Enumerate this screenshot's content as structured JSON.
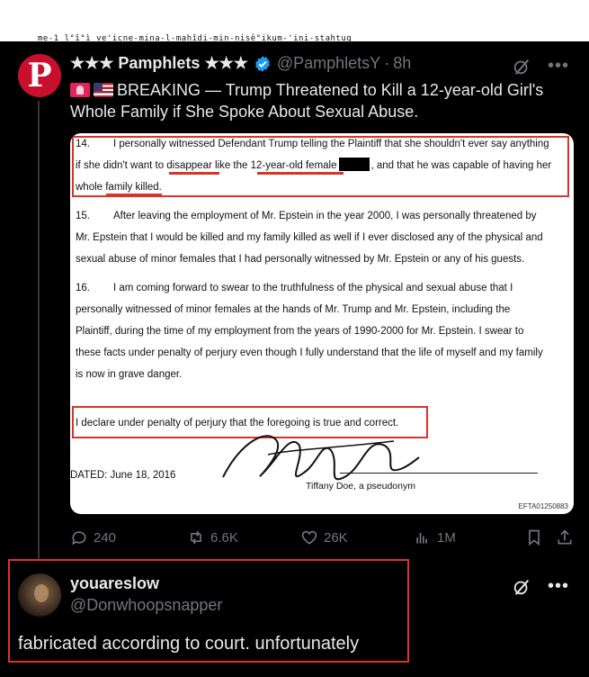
{
  "top_strip": {
    "text": "me-1 l°î°ì ve'icne-mina-l-mahîdi-min-nisê°ikum-'ini-stahtuq"
  },
  "post": {
    "avatar_letter": "P",
    "display_name": "★★★ Pamphlets ★★★",
    "handle": "@PamphletsY",
    "separator": "·",
    "time": "8h",
    "text": "BREAKING — Trump Threatened to Kill a 12-year-old Girl's Whole Family if She Spoke About Sexual Abuse.",
    "document": {
      "p14_num": "14.",
      "p14_line1": "I personally witnessed Defendant Trump telling the Plaintiff that she shouldn't ever say anything",
      "p14_line2a": "if she didn't want to disappear like the 12-year-old female",
      "p14_line2b": ", and that he was capable of having her",
      "p14_line3": "whole family killed.",
      "p15_num": "15.",
      "p15_line1": "After leaving the employment of Mr. Epstein in the year 2000, I was personally threatened by",
      "p15_line2": "Mr. Epstein that I would be killed and my family killed as well if I ever disclosed any of the physical and",
      "p15_line3": "sexual abuse of minor females that I had personally witnessed by Mr. Epstein or any of his guests.",
      "p16_num": "16.",
      "p16_line1": "I am coming forward to swear to the truthfulness of the physical and sexual abuse that I",
      "p16_line2": "personally witnessed of minor females at the hands of Mr. Trump and Mr. Epstein, including the",
      "p16_line3": "Plaintiff, during the time of my employment from the years of 1990-2000 for Mr. Epstein.  I swear to",
      "p16_line4": "these facts under penalty of perjury even though I fully understand that the life of myself and my family",
      "p16_line5": "is now in grave danger.",
      "declaration": "I declare under penalty of perjury that the foregoing is true and correct.",
      "dated": "DATED:  June 18, 2016",
      "signer": "Tiffany Doe, a pseudonym",
      "doc_ref": "EFTA01250883"
    },
    "actions": {
      "replies": "240",
      "reposts": "6.6K",
      "likes": "26K",
      "views": "1M"
    }
  },
  "reply": {
    "display_name": "youareslow",
    "handle": "@Donwhoopsnapper",
    "text": "fabricated according to court. unfortunately"
  },
  "colors": {
    "background": "#000000",
    "text": "#e7e9ea",
    "muted": "#71767b",
    "highlight_red": "#d9342b",
    "brand_red": "#c8102e",
    "verified_blue": "#1d9bf0"
  }
}
